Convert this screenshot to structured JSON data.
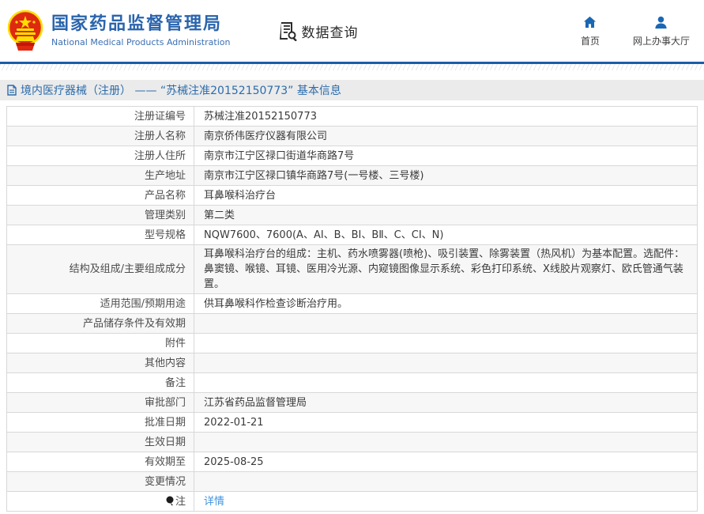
{
  "header": {
    "title": "国家药品监督管理局",
    "subtitle": "National Medical Products Administration",
    "data_query_label": "数据查询",
    "nav": [
      {
        "label": "首页",
        "icon": "home-icon"
      },
      {
        "label": "网上办事大厅",
        "icon": "user-icon"
      }
    ]
  },
  "breadcrumb": {
    "text": "境内医疗器械（注册） —— “苏械注准20152150773” 基本信息"
  },
  "table": {
    "rows": [
      {
        "label": "注册证编号",
        "value": "苏械注准20152150773"
      },
      {
        "label": "注册人名称",
        "value": "南京侨伟医疗仪器有限公司"
      },
      {
        "label": "注册人住所",
        "value": "南京市江宁区禄口街道华商路7号"
      },
      {
        "label": "生产地址",
        "value": "南京市江宁区禄口镇华商路7号(一号楼、三号楼)"
      },
      {
        "label": "产品名称",
        "value": "耳鼻喉科治疗台"
      },
      {
        "label": "管理类别",
        "value": "第二类"
      },
      {
        "label": "型号规格",
        "value": "NQW7600、7600(A、AI、B、BI、BⅡ、C、CI、N)"
      },
      {
        "label": "结构及组成/主要组成成分",
        "value": "耳鼻喉科治疗台的组成：主机、药水喷雾器(喷枪)、吸引装置、除雾装置（热风机）为基本配置。选配件：鼻窦镜、喉镜、耳镜、医用冷光源、内窥镜图像显示系统、彩色打印系统、X线胶片观察灯、欧氏管通气装置。"
      },
      {
        "label": "适用范围/预期用途",
        "value": "供耳鼻喉科作检查诊断治疗用。"
      },
      {
        "label": "产品储存条件及有效期",
        "value": ""
      },
      {
        "label": "附件",
        "value": ""
      },
      {
        "label": "其他内容",
        "value": ""
      },
      {
        "label": "备注",
        "value": ""
      },
      {
        "label": "审批部门",
        "value": "江苏省药品监督管理局"
      },
      {
        "label": "批准日期",
        "value": "2022-01-21"
      },
      {
        "label": "生效日期",
        "value": ""
      },
      {
        "label": "有效期至",
        "value": "2025-08-25"
      },
      {
        "label": "变更情况",
        "value": ""
      },
      {
        "label": "注",
        "value": "详情",
        "link": true,
        "note_icon": true
      }
    ]
  },
  "colors": {
    "title_blue": "#2a64ad",
    "rule_blue": "#1a5dab",
    "icon_blue": "#1a67b4",
    "crumb_bg": "#ebebeb",
    "crumb_text": "#2c6cab",
    "link_blue": "#4193de",
    "row_alt": "#f7f7f7",
    "border": "#d8d8d8",
    "emblem_red": "#de2910",
    "emblem_gold": "#ffde00"
  }
}
